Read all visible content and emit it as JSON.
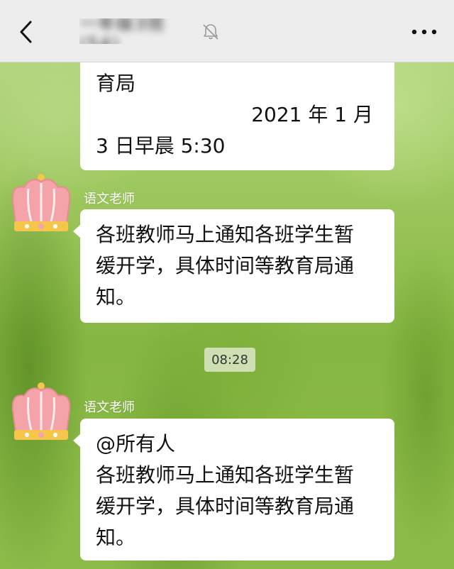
{
  "header": {
    "title": "一年级3班(54)",
    "back_icon": "back-chevron-icon",
    "mute_icon": "mute-bell-icon",
    "more_icon": "more-dots-icon"
  },
  "messages": [
    {
      "lines": [
        "育局",
        "2021 年 1 月",
        "3 日早晨 5:30"
      ]
    },
    {
      "sender": "语文老师",
      "lines": [
        "各班教师马上通知各班学生暂",
        "缓开学，具体时间等教育局通",
        "知。"
      ]
    },
    {
      "sender": "语文老师",
      "lines": [
        "@所有人",
        "各班教师马上通知各班学生暂",
        "缓开学，具体时间等教育局通",
        "知。"
      ]
    }
  ],
  "time_separator": "08:28",
  "colors": {
    "topbar_bg": "#ededed",
    "bubble_bg": "#ffffff",
    "crown_pink": "#f4a3a8",
    "crown_gold": "#f6c64a"
  }
}
